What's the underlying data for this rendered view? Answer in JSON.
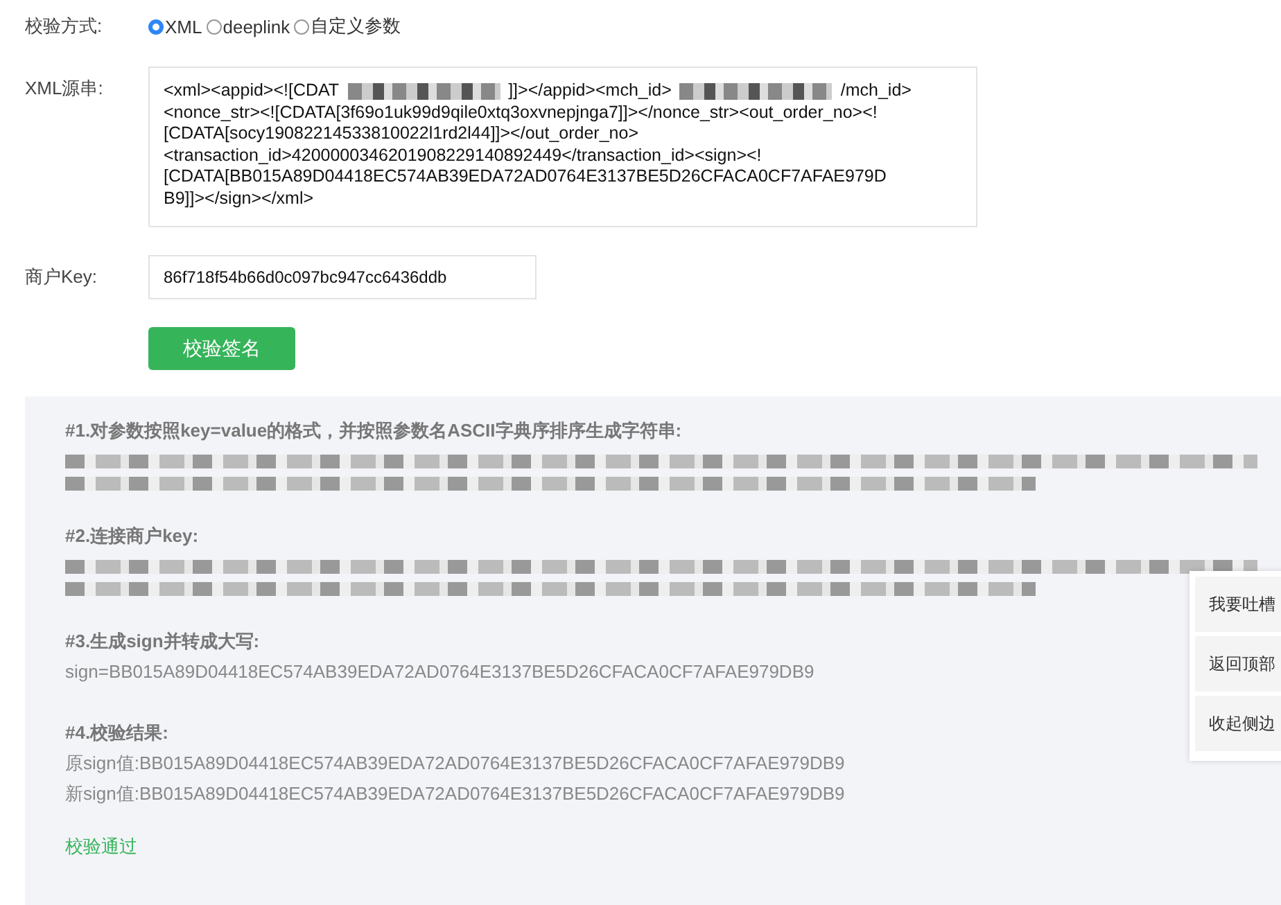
{
  "verify_mode": {
    "label": "校验方式:",
    "options": [
      {
        "label": "XML",
        "selected": true
      },
      {
        "label": "deeplink",
        "selected": false
      },
      {
        "label": "自定义参数",
        "selected": false
      }
    ]
  },
  "xml_source": {
    "label": "XML源串:",
    "lines": [
      [
        {
          "kind": "text",
          "text": "<xml><appid><![CDAT"
        },
        {
          "kind": "redacted"
        },
        {
          "kind": "text",
          "text": "]]></appid><mch_id>"
        },
        {
          "kind": "redacted"
        },
        {
          "kind": "text",
          "text": "/mch_id>"
        }
      ],
      [
        {
          "kind": "text",
          "text": "<nonce_str><![CDATA[3f69o1uk99d9qile0xtq3oxvnepjnga7]]></nonce_str><out_order_no><!"
        }
      ],
      [
        {
          "kind": "text",
          "text": "[CDATA[socy19082214533810022l1rd2l44]]></out_order_no>"
        }
      ],
      [
        {
          "kind": "text",
          "text": "<transaction_id>4200000346201908229140892449</transaction_id><sign><!"
        }
      ],
      [
        {
          "kind": "text",
          "text": "[CDATA[BB015A89D04418EC574AB39EDA72AD0764E3137BE5D26CFACA0CF7AFAE979D"
        }
      ],
      [
        {
          "kind": "text",
          "text": "B9]]></sign></xml>"
        }
      ]
    ]
  },
  "merchant_key": {
    "label": "商户Key:",
    "value": "86f718f54b66d0c097bc947cc6436ddb"
  },
  "verify_button": "校验签名",
  "steps": [
    {
      "title": "#1.对参数按照key=value的格式，并按照参数名ASCII字典序排序生成字符串:",
      "lines": [
        {
          "kind": "redacted"
        },
        {
          "kind": "redacted"
        }
      ]
    },
    {
      "title": "#2.连接商户key:",
      "lines": [
        {
          "kind": "redacted"
        },
        {
          "kind": "redacted"
        }
      ]
    },
    {
      "title": "#3.生成sign并转成大写:",
      "lines": [
        {
          "kind": "text",
          "text": "sign=BB015A89D04418EC574AB39EDA72AD0764E3137BE5D26CFACA0CF7AFAE979DB9"
        }
      ]
    },
    {
      "title": "#4.校验结果:",
      "lines": [
        {
          "kind": "text",
          "text": "原sign值:BB015A89D04418EC574AB39EDA72AD0764E3137BE5D26CFACA0CF7AFAE979DB9"
        },
        {
          "kind": "text",
          "text": "新sign值:BB015A89D04418EC574AB39EDA72AD0764E3137BE5D26CFACA0CF7AFAE979DB9"
        }
      ]
    }
  ],
  "result": {
    "text": "校验通过",
    "passed": true
  },
  "side_panel": [
    "我要吐槽",
    "返回顶部",
    "收起侧边"
  ]
}
